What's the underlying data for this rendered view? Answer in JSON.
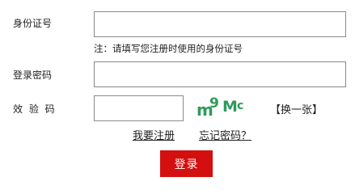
{
  "form": {
    "id_label": "身份证号",
    "id_value": "",
    "id_hint": "注：请填写您注册时使用的身份证号",
    "password_label": "登录密码",
    "password_value": "",
    "captcha_label": "效 验 码",
    "captcha_value": "",
    "captcha_text": [
      "m",
      "9",
      "M",
      "c"
    ],
    "refresh_label": "【换一张】",
    "register_link": "我要注册",
    "forgot_link": "忘记密码？",
    "login_button": "登录"
  },
  "colors": {
    "accent": "#d40f0f",
    "captcha": "#2f9a5a",
    "border": "#8a8a8a"
  }
}
